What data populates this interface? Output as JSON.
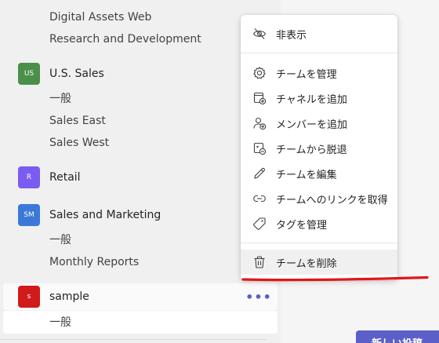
{
  "sidebar": {
    "channels_top": [
      {
        "label": "Digital Assets Web"
      },
      {
        "label": "Research and Development"
      }
    ],
    "teams": [
      {
        "name": "U.S. Sales",
        "avatar_text": "US",
        "avatar_color": "#4a8f4a",
        "channels": [
          "一般",
          "Sales East",
          "Sales West"
        ]
      },
      {
        "name": "Retail",
        "avatar_text": "R",
        "avatar_color": "#7b5cf0",
        "channels": []
      },
      {
        "name": "Sales and Marketing",
        "avatar_text": "SM",
        "avatar_color": "#3c78d8",
        "channels": [
          "一般",
          "Monthly Reports"
        ]
      },
      {
        "name": "sample",
        "avatar_text": "s",
        "avatar_color": "#d11a1a",
        "channels": [
          "一般"
        ],
        "more_label": "•••"
      }
    ]
  },
  "context_menu": {
    "items": [
      {
        "label": "非表示",
        "icon": "hide-icon"
      },
      {
        "label": "チームを管理",
        "icon": "gear-icon"
      },
      {
        "label": "チャネルを追加",
        "icon": "add-channel-icon"
      },
      {
        "label": "メンバーを追加",
        "icon": "add-member-icon"
      },
      {
        "label": "チームから脱退",
        "icon": "leave-team-icon"
      },
      {
        "label": "チームを編集",
        "icon": "pencil-icon"
      },
      {
        "label": "チームへのリンクを取得",
        "icon": "link-icon"
      },
      {
        "label": "タグを管理",
        "icon": "tag-icon"
      },
      {
        "label": "チームを削除",
        "icon": "trash-icon"
      }
    ],
    "highlight_color": "#e3151a"
  },
  "main": {
    "new_button_label": "新しい投稿"
  },
  "colors": {
    "accent": "#5b5fc7",
    "sidebar_bg": "#f0f0f0",
    "main_bg": "#f5f5f5"
  }
}
